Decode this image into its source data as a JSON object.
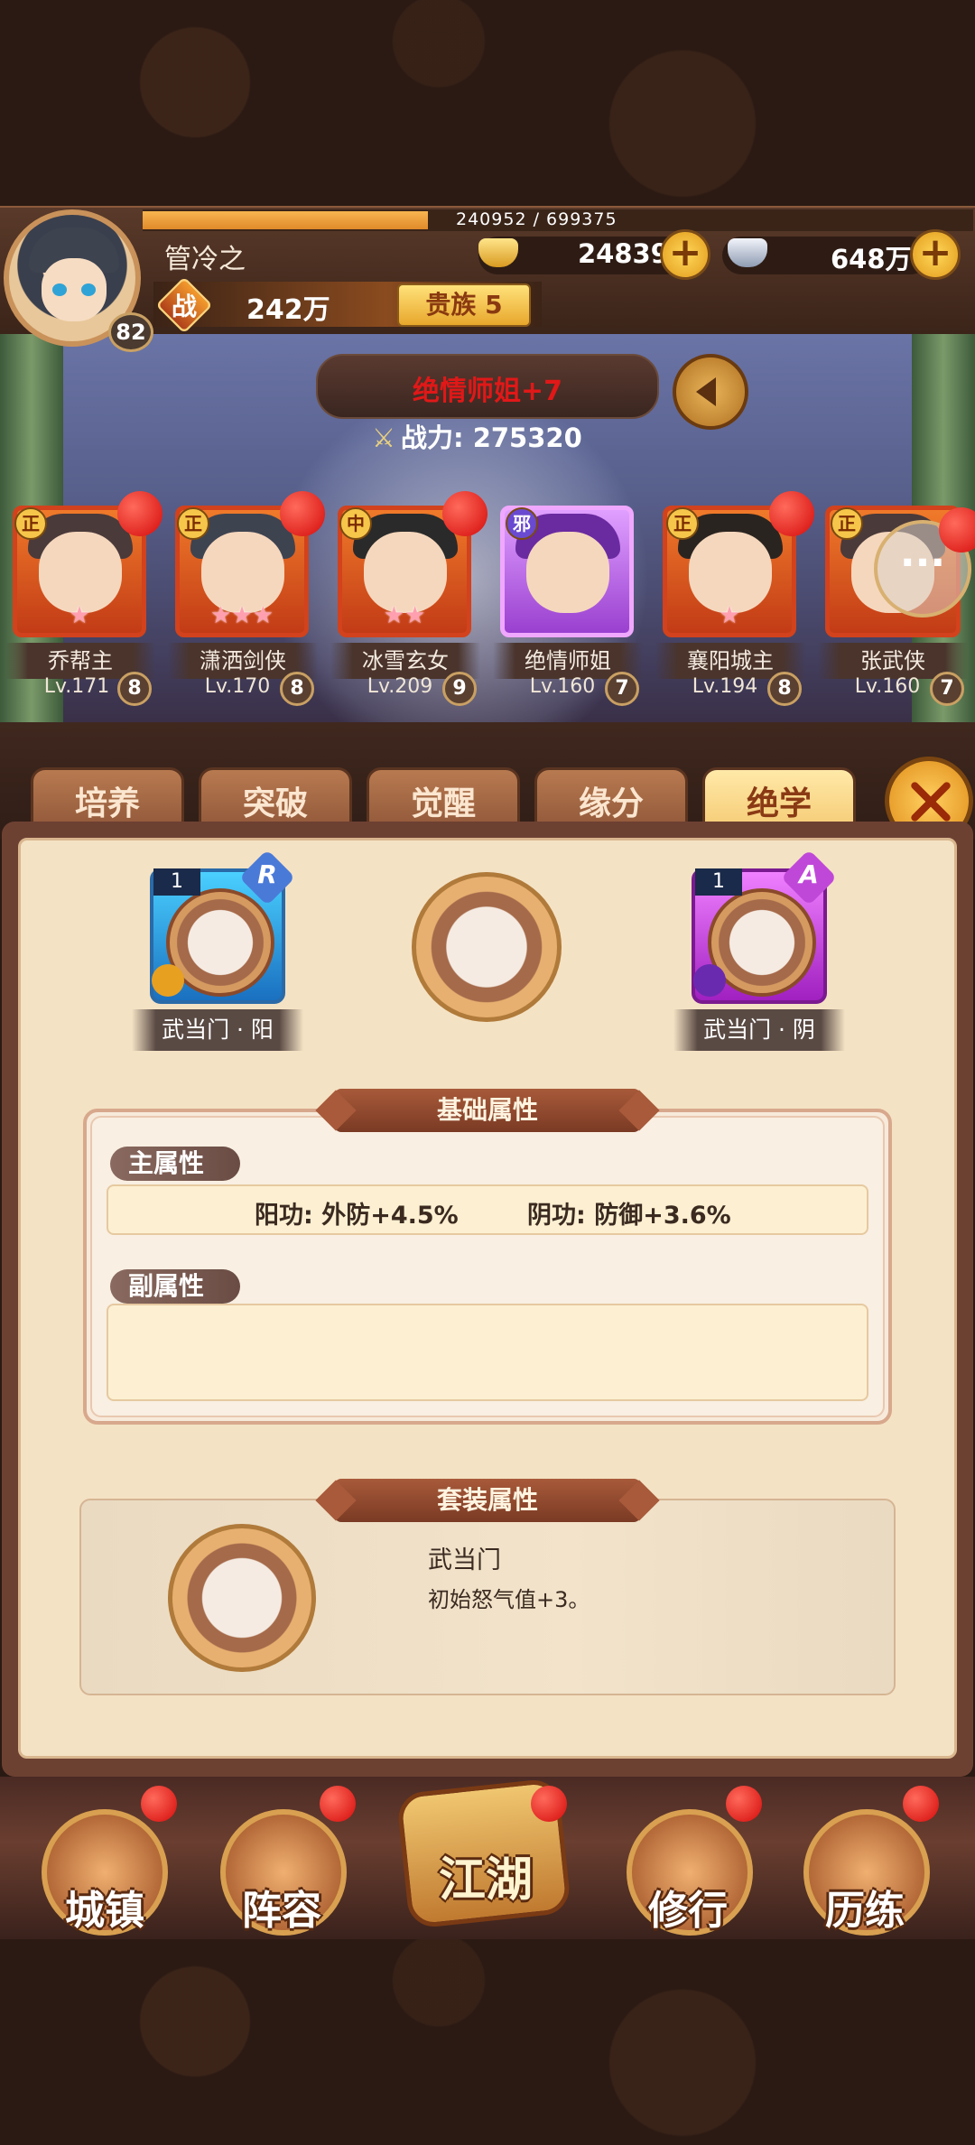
{
  "player": {
    "name": "管冷之",
    "level": "82",
    "exp_text": "240952 / 699375",
    "exp_fraction": 0.344,
    "power": "242万",
    "power_icon_text": "战",
    "noble": "贵族 5"
  },
  "currency": {
    "gold": "24839",
    "silver": "648万"
  },
  "hero_display": {
    "title": "绝情师姐+7",
    "combat_power": "战力: 275320"
  },
  "heroes": [
    {
      "faction": "正",
      "name": "乔帮主",
      "level": "Lv.171",
      "star": "8",
      "stars": 1,
      "reddot": true
    },
    {
      "faction": "正",
      "name": "潇洒剑侠",
      "level": "Lv.170",
      "star": "8",
      "stars": 3,
      "reddot": true
    },
    {
      "faction": "中",
      "name": "冰雪玄女",
      "level": "Lv.209",
      "star": "9",
      "stars": 2,
      "reddot": true
    },
    {
      "faction": "邪",
      "name": "绝情师姐",
      "level": "Lv.160",
      "star": "7",
      "stars": 0,
      "reddot": false,
      "selected": true
    },
    {
      "faction": "正",
      "name": "襄阳城主",
      "level": "Lv.194",
      "star": "8",
      "stars": 1,
      "reddot": true
    },
    {
      "faction": "正",
      "name": "张武侠",
      "level": "Lv.160",
      "star": "7",
      "stars": 1,
      "reddot": true
    }
  ],
  "tabs": [
    "培养",
    "突破",
    "觉醒",
    "缘分",
    "绝学"
  ],
  "active_tab": "绝学",
  "skills": {
    "yang": {
      "level": "1",
      "grade": "R",
      "label": "武当门 · 阳"
    },
    "yin": {
      "level": "1",
      "grade": "A",
      "label": "武当门 · 阴"
    }
  },
  "base_attrs": {
    "title": "基础属性",
    "main_label": "主属性",
    "main_yang": "阳功: 外防+4.5%",
    "main_yin": "阴功: 防御+3.6%",
    "sub_label": "副属性"
  },
  "set_attrs": {
    "title": "套装属性",
    "name": "武当门",
    "desc": "初始怒气值+3。"
  },
  "nav": [
    "城镇",
    "阵容",
    "江湖",
    "修行",
    "历练"
  ],
  "colors": {
    "accent": "#f3c56a",
    "alert_red": "#e01818",
    "grade_r": "#1a70c0",
    "grade_a": "#a020c0"
  },
  "icons": [
    "sound-icon",
    "chat-icon",
    "close-icon",
    "gold-ingot-icon",
    "silver-ingot-icon",
    "plus-icon",
    "crossed-swords-icon"
  ]
}
